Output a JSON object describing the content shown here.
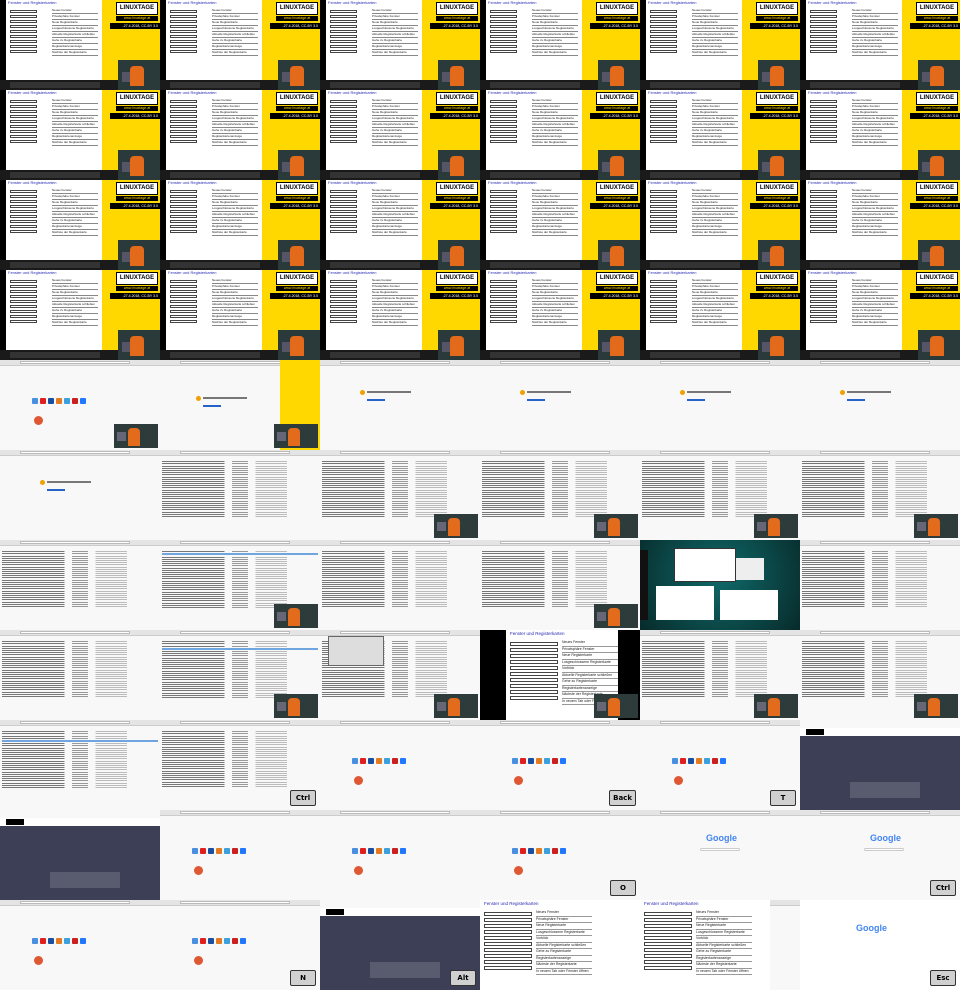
{
  "yellow_slide": {
    "title": "Fenster und Registerkarten",
    "logo": "LINUXTAGE",
    "url": "www.linuxtage.at",
    "date": "-27.4.2018, CC-BY 3.0",
    "items": [
      "Neues Fenster",
      "Privatsphäre Fenster",
      "Neue Registerkarte",
      "Losgeschlossene Registerkarte",
      "Vorblick",
      "Aktuelle Registerkarte schließen",
      "Gehe zu Registerkarte",
      "Registerkartenanzeige",
      "Nächste der Registerkarte",
      "In neuem Tab oder Fenster öffnen"
    ]
  },
  "google": {
    "logo": "Google"
  },
  "keys": {
    "ctrl": "Ctrl",
    "back": "Back",
    "t": "T",
    "o": "O",
    "n": "N",
    "alt": "Alt",
    "esc": "Esc"
  },
  "shortcut_slide": {
    "title": "Fenster und Registerkarten",
    "items": [
      "Neues Fenster",
      "Privatsphäre Fenster",
      "Neue Registerkarte",
      "Losgeschlossene Registerkarte",
      "Vorblick",
      "Aktuelle Registerkarte schließen",
      "Gehe zu Registerkarte",
      "Registerkartenanzeige",
      "Nächste der Registerkarte",
      "In neuem Tab oder Fenster öffnen"
    ]
  }
}
